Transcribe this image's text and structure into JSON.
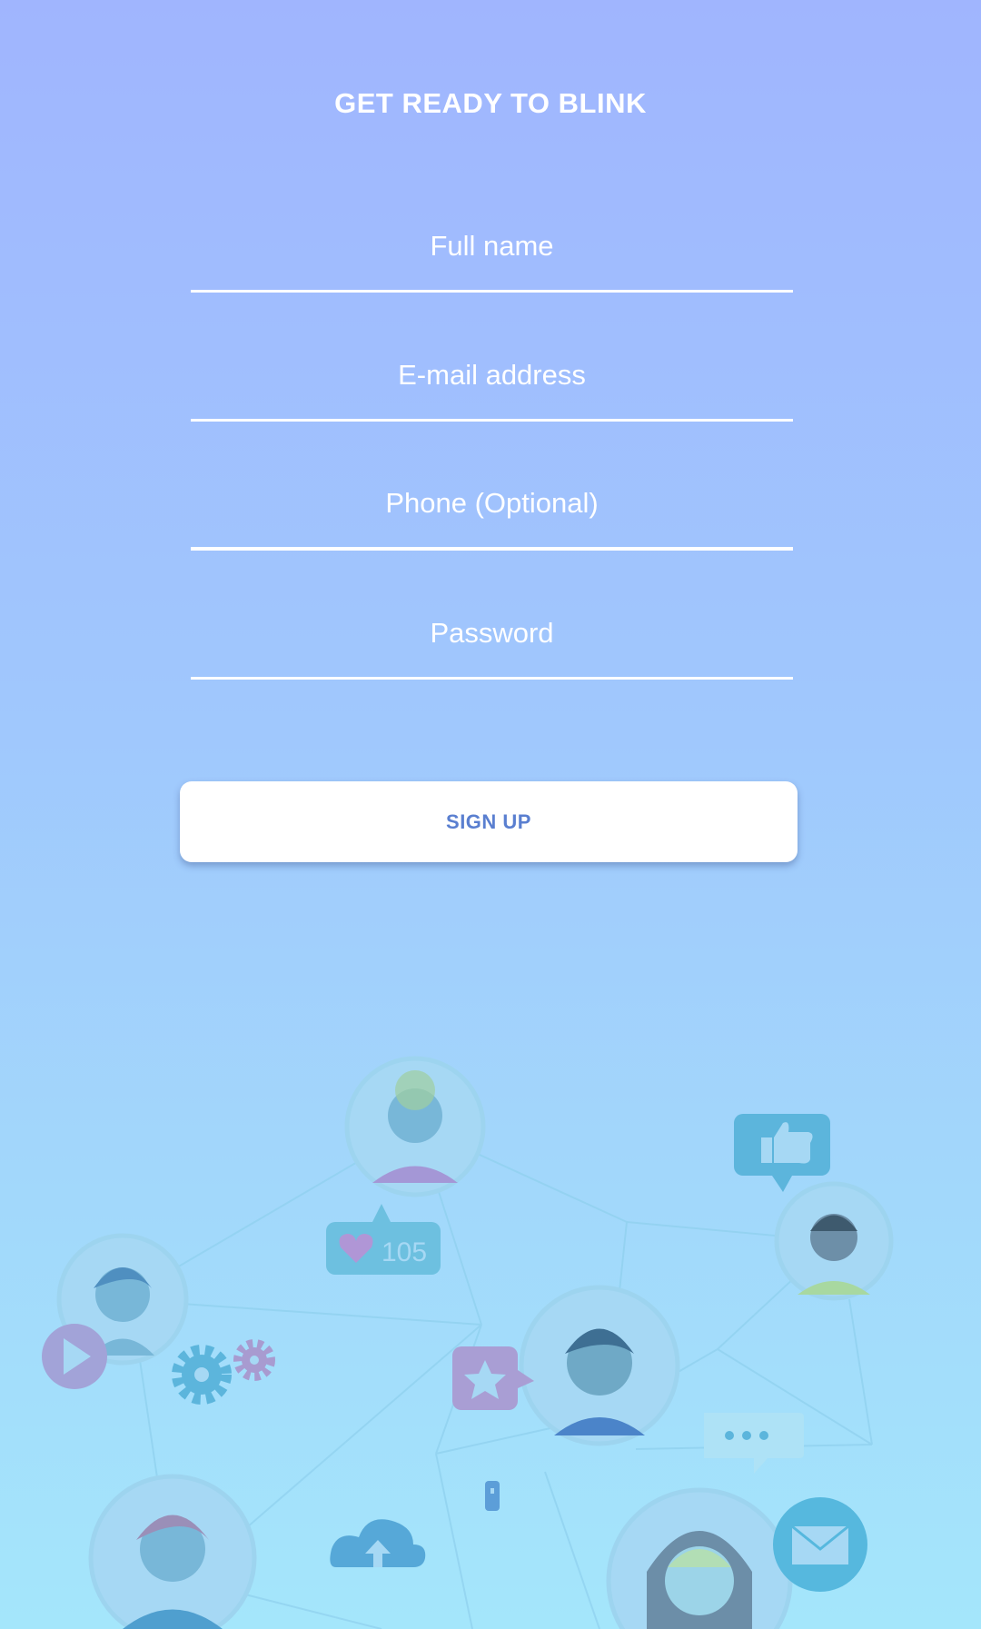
{
  "header": {
    "title": "GET READY TO BLINK"
  },
  "form": {
    "full_name": {
      "placeholder": "Full name",
      "value": ""
    },
    "email": {
      "placeholder": "E-mail address",
      "value": ""
    },
    "phone": {
      "placeholder": "Phone (Optional)",
      "value": ""
    },
    "password": {
      "placeholder": "Password",
      "value": ""
    },
    "signup_label": "SIGN UP"
  },
  "illustration": {
    "like_count": "105"
  },
  "colors": {
    "background_top": "#a0b5fe",
    "background_bottom": "#a4e6fb",
    "button_text": "#5a7fd0"
  }
}
